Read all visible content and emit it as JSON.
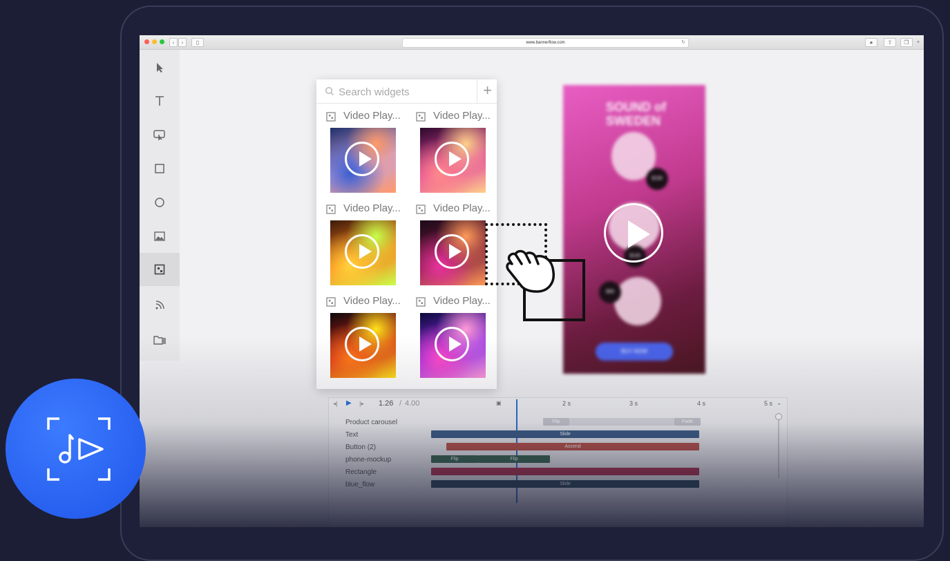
{
  "browser": {
    "url": "www.bannerflow.com"
  },
  "toolbar": {
    "tools": [
      "select-icon",
      "text-icon",
      "video-icon",
      "rectangle-icon",
      "ellipse-icon",
      "image-icon",
      "widget-icon",
      "feed-icon",
      "library-icon"
    ]
  },
  "widget_panel": {
    "search_placeholder": "Search widgets",
    "add_label": "+",
    "widgets": [
      {
        "label": "Video Play...",
        "gradient": [
          "#1f2f6a",
          "#c8a0d8",
          "#3a5fd0",
          "#ff9a6a"
        ]
      },
      {
        "label": "Video Play...",
        "gradient": [
          "#2a0a2a",
          "#e03d9e",
          "#ff8a8a",
          "#ffd18a"
        ]
      },
      {
        "label": "Video Play...",
        "gradient": [
          "#3a1a0a",
          "#ff7a1a",
          "#ffd23a",
          "#c8ff4a"
        ]
      },
      {
        "label": "Video Play...",
        "gradient": [
          "#1a0a1a",
          "#7a1a3a",
          "#e8329e",
          "#ff9a5a"
        ]
      },
      {
        "label": "Video Play...",
        "gradient": [
          "#0a0a0a",
          "#d2201a",
          "#ff7a1a",
          "#ffe21a"
        ]
      },
      {
        "label": "Video Play...",
        "gradient": [
          "#0a0a3a",
          "#8a2ae8",
          "#ff4ac8",
          "#ff9ad8"
        ]
      }
    ]
  },
  "banner": {
    "title_line1": "SOUND of",
    "title_line2": "SWEDEN",
    "price_1": "$199",
    "price_2": "$149",
    "price_3": "$99",
    "cta": "BUY NOW"
  },
  "timeline": {
    "current_time": "1.26",
    "separator": "/",
    "total_time": "4.00",
    "ticks": [
      "2 s",
      "3 s",
      "4 s",
      "5 s"
    ],
    "layers": [
      {
        "name": "Product carousel",
        "bars": [
          {
            "label": "Flip",
            "color": "#c8c8d0"
          },
          {
            "label": "",
            "color": "#dcdce2"
          },
          {
            "label": "Fade",
            "color": "#c8c8d0"
          }
        ]
      },
      {
        "name": "Text",
        "bars": [
          {
            "label": "Slide",
            "color": "#3e5f8a"
          }
        ]
      },
      {
        "name": "Button (2)",
        "bars": [
          {
            "label": "Ascend",
            "color": "#c3554a"
          }
        ]
      },
      {
        "name": "phone-mockup",
        "bars": [
          {
            "label": "Flip",
            "color": "#3a6a52"
          },
          {
            "label": "Flip",
            "color": "#3a6a52"
          }
        ]
      },
      {
        "name": "Rectangle",
        "bars": [
          {
            "label": "",
            "color": "#b8334e"
          }
        ]
      },
      {
        "name": "blue_flow",
        "bars": [
          {
            "label": "Slide",
            "color": "#2a4a5a"
          }
        ]
      }
    ],
    "progress_fraction": 0.315
  },
  "colors": {
    "background": "#1c1e36",
    "badge": "#2a63f0",
    "playhead": "#2a6fd6"
  }
}
